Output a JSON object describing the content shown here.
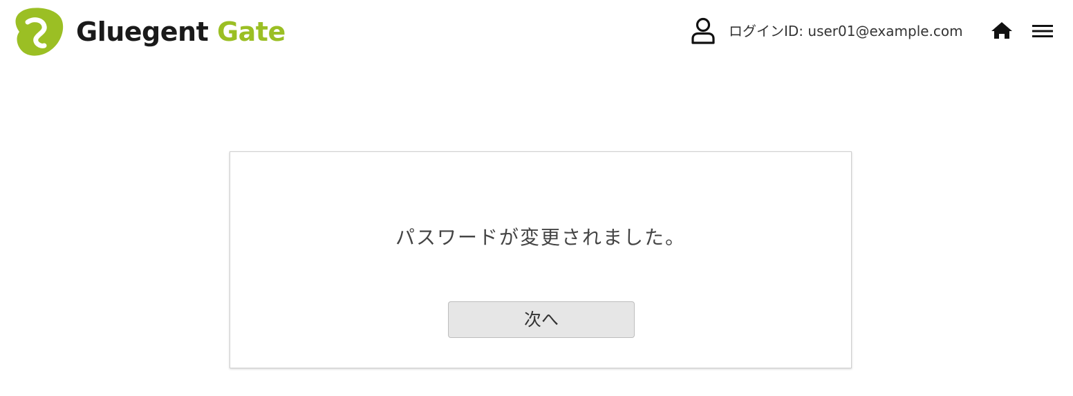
{
  "header": {
    "logo": {
      "word1": "Gluegent",
      "word2": "Gate"
    },
    "user_icon": "user-icon",
    "login_id": "ログインID: user01@example.com",
    "home_icon": "home-icon",
    "menu_icon": "hamburger-menu-icon"
  },
  "main": {
    "message": "パスワードが変更されました。",
    "next_button_label": "次へ"
  },
  "colors": {
    "brand_green": "#9bbf24",
    "text_dark": "#1a1a1a",
    "button_bg": "#e6e6e6"
  }
}
